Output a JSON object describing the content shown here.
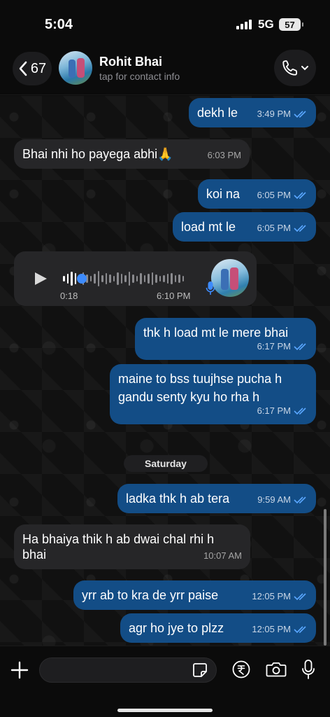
{
  "status_bar": {
    "time": "5:04",
    "network": "5G",
    "battery": "57"
  },
  "header": {
    "back_count": "67",
    "contact_name": "Rohit Bhai",
    "contact_subtitle": "tap for contact info"
  },
  "messages": [
    {
      "dir": "out",
      "text": "dekh le",
      "time": "3:49 PM"
    },
    {
      "dir": "in",
      "text": "Bhai nhi ho payega abhi🙏",
      "time": "6:03 PM"
    },
    {
      "dir": "out",
      "text": "koi na",
      "time": "6:05 PM"
    },
    {
      "dir": "out",
      "text": "load mt le",
      "time": "6:05 PM"
    },
    {
      "dir": "in",
      "type": "voice",
      "duration": "0:18",
      "time": "6:10 PM",
      "played_fraction": 0.12
    },
    {
      "dir": "out",
      "text": "thk h load mt le mere bhai",
      "time": "6:17 PM"
    },
    {
      "dir": "out",
      "text_line1": "maine to bss tuujhse pucha h",
      "text_line2": "gandu senty kyu ho rha h",
      "time": "6:17 PM"
    },
    {
      "dir": "out",
      "text": "ladka thk h ab tera",
      "time": "9:59 AM"
    },
    {
      "dir": "in",
      "text_line1": "Ha bhaiya thik h ab dwai chal rhi h",
      "text_line2": "bhai",
      "time": "10:07 AM"
    },
    {
      "dir": "out",
      "text": "yrr ab to kra de yrr paise",
      "time": "12:05 PM"
    },
    {
      "dir": "out",
      "text": "agr ho jye to plzz",
      "time": "12:05 PM"
    }
  ],
  "date_separator": "Saturday",
  "composer": {
    "placeholder": ""
  },
  "colors": {
    "outgoing_bubble": "#134d86",
    "incoming_bubble": "#262628",
    "read_ticks": "#5aa7ff"
  },
  "icons": [
    "back-chevron-icon",
    "phone-icon",
    "chevron-down-icon",
    "double-tick-icon",
    "play-icon",
    "mic-icon",
    "plus-icon",
    "sticker-icon",
    "rupee-icon",
    "camera-icon"
  ]
}
